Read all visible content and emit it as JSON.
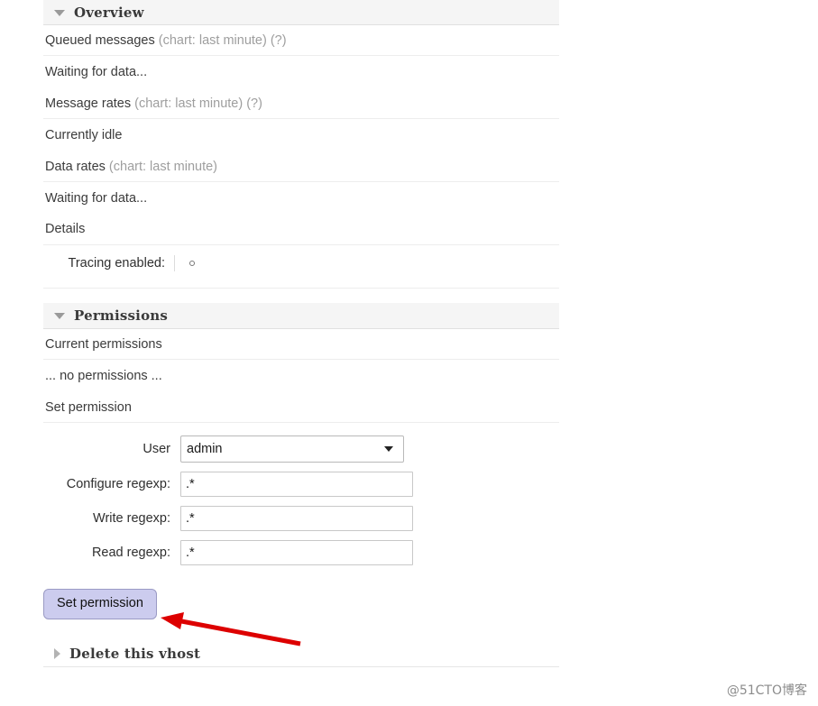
{
  "sections": {
    "overview": {
      "title": "Overview",
      "toggle_icon": "triangle-down-icon",
      "rows": [
        {
          "label": "Queued messages",
          "muted": " (chart: last minute) (?)"
        },
        {
          "label": "Waiting for data...",
          "muted": ""
        },
        {
          "label": "Message rates",
          "muted": " (chart: last minute) (?)"
        },
        {
          "label": "Currently idle",
          "muted": ""
        },
        {
          "label": "Data rates",
          "muted": " (chart: last minute)"
        },
        {
          "label": "Waiting for data...",
          "muted": ""
        },
        {
          "label": "Details",
          "muted": ""
        }
      ],
      "details": {
        "key": "Tracing enabled:",
        "value_icon": "small-circle-icon",
        "value": ""
      }
    },
    "permissions": {
      "title": "Permissions",
      "toggle_icon": "triangle-down-icon",
      "current_permissions_label": "Current permissions",
      "no_permissions_text": "... no permissions ...",
      "set_permission_label": "Set permission",
      "form": {
        "user": {
          "label": "User",
          "value": "admin",
          "options": [
            "admin"
          ],
          "caret_icon": "chevron-down-icon"
        },
        "configure": {
          "label": "Configure regexp:",
          "value": ".*",
          "placeholder": ""
        },
        "write": {
          "label": "Write regexp:",
          "value": ".*",
          "placeholder": ""
        },
        "read": {
          "label": "Read regexp:",
          "value": ".*",
          "placeholder": ""
        },
        "submit_label": "Set permission"
      }
    },
    "delete": {
      "title": "Delete this vhost",
      "toggle_icon": "triangle-right-icon"
    }
  },
  "annotation": {
    "arrow_color": "#dd0000",
    "points_to": "Set permission"
  },
  "watermark": "@51CTO博客"
}
